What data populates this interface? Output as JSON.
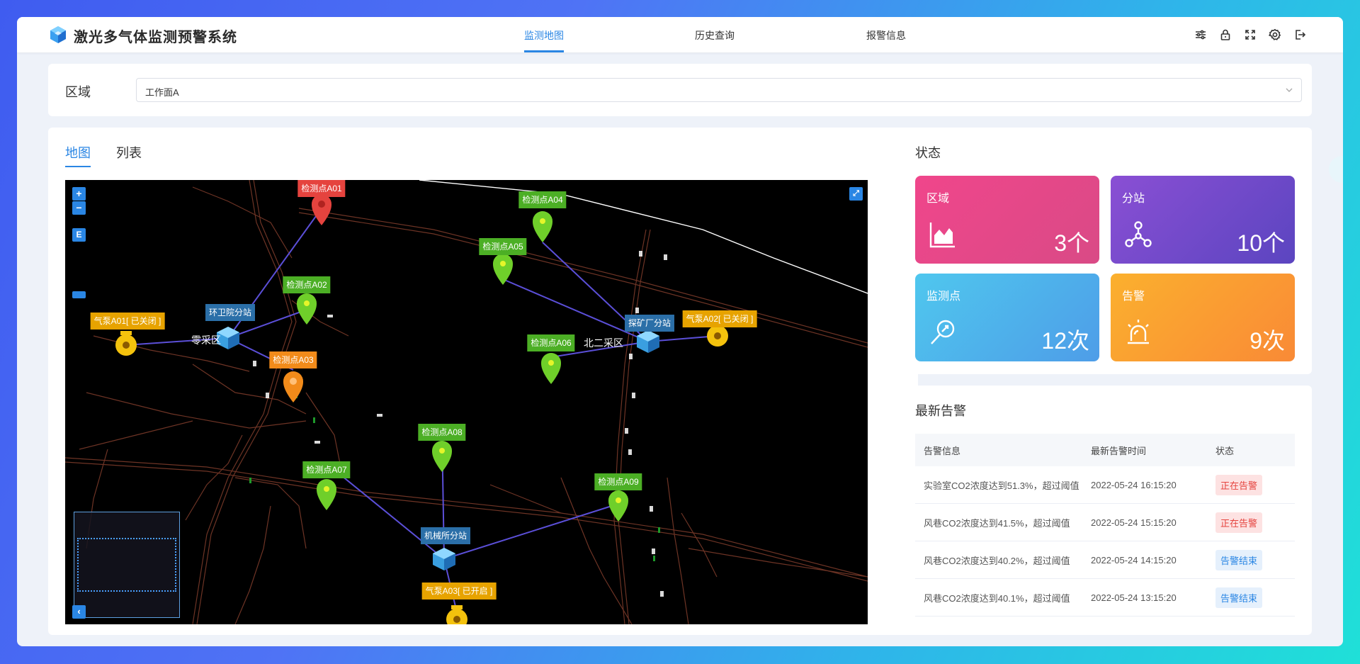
{
  "header": {
    "title": "激光多气体监测预警系统",
    "nav": [
      "监测地图",
      "历史查询",
      "报警信息"
    ],
    "icons": [
      "sliders-icon",
      "lock-icon",
      "fullscreen-icon",
      "settings-icon",
      "logout-icon"
    ]
  },
  "filter": {
    "label": "区域",
    "value": "工作面A"
  },
  "tabs": [
    "地图",
    "列表"
  ],
  "map": {
    "zoom_in": "+",
    "zoom_out": "−",
    "e_button": "E",
    "collapse": "‹",
    "labels": {
      "a01": "检测点A01",
      "a02": "检测点A02",
      "a03": "检测点A03",
      "a04": "检测点A04",
      "a05": "检测点A05",
      "a06": "检测点A06",
      "a07": "检测点A07",
      "a08": "检测点A08",
      "a09": "检测点A09",
      "s_huanwei": "环卫院分站",
      "s_tankuang": "探矿厂分站",
      "s_jixie": "机械所分站",
      "p_a01": "气泵A01[ 已关闭 ]",
      "p_a02": "气泵A02[ 已关闭 ]",
      "p_a03": "气泵A03[ 已开启 ]"
    },
    "texts": {
      "area_lingcai": "零采区",
      "area_beier": "北二采区"
    },
    "colors": {
      "normal": "#6fcf2a",
      "alarm": "#e5433e",
      "warning": "#f28b1a",
      "pump": "#f4c20d",
      "station": "#4ab3ea",
      "link": "#5b4fd8"
    }
  },
  "status": {
    "title": "状态",
    "tiles": [
      {
        "label": "区域",
        "value": "3个",
        "icon": "area-chart-icon"
      },
      {
        "label": "分站",
        "value": "10个",
        "icon": "network-icon"
      },
      {
        "label": "监测点",
        "value": "12次",
        "icon": "probe-icon"
      },
      {
        "label": "告警",
        "value": "9次",
        "icon": "alarm-light-icon"
      }
    ]
  },
  "alarms": {
    "title": "最新告警",
    "columns": [
      "告警信息",
      "最新告警时间",
      "状态"
    ],
    "rows": [
      {
        "info": "实验室CO2浓度达到51.3%，超过阈值",
        "time": "2022-05-24 16:15:20",
        "status": "正在告警",
        "type": "red"
      },
      {
        "info": "风巷CO2浓度达到41.5%，超过阈值",
        "time": "2022-05-24 15:15:20",
        "status": "正在告警",
        "type": "red"
      },
      {
        "info": "风巷CO2浓度达到40.2%，超过阈值",
        "time": "2022-05-24 14:15:20",
        "status": "告警结束",
        "type": "blue"
      },
      {
        "info": "风巷CO2浓度达到40.1%，超过阈值",
        "time": "2022-05-24 13:15:20",
        "status": "告警结束",
        "type": "blue"
      }
    ]
  }
}
